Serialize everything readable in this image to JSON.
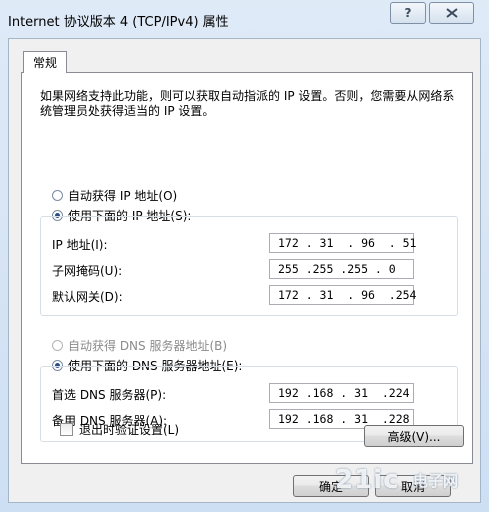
{
  "window": {
    "title": "Internet 协议版本 4 (TCP/IPv4) 属性",
    "help_glyph": "?",
    "close_glyph": "⌧"
  },
  "tabs": [
    {
      "label": "常规"
    }
  ],
  "description": "如果网络支持此功能，则可以获取自动指派的 IP 设置。否则，您需要从网络系统管理员处获得适当的 IP 设置。",
  "ip_section": {
    "auto_label": "自动获得 IP 地址(O)",
    "manual_label": "使用下面的 IP 地址(S):",
    "selected": "manual",
    "fields": [
      {
        "label": "IP 地址(I):",
        "value": "172 . 31  . 96  . 51"
      },
      {
        "label": "子网掩码(U):",
        "value": "255 .255 .255 . 0"
      },
      {
        "label": "默认网关(D):",
        "value": "172 . 31  . 96  .254"
      }
    ]
  },
  "dns_section": {
    "auto_label": "自动获得 DNS 服务器地址(B)",
    "manual_label": "使用下面的 DNS 服务器地址(E):",
    "selected": "manual",
    "fields": [
      {
        "label": "首选 DNS 服务器(P):",
        "value": "192 .168 . 31  .224"
      },
      {
        "label": "备用 DNS 服务器(A):",
        "value": "192 .168 . 31  .228"
      }
    ]
  },
  "validate_checkbox": {
    "label": "退出时验证设置(L)",
    "checked": false
  },
  "buttons": {
    "advanced": "高级(V)...",
    "ok": "确定",
    "cancel": "取消"
  },
  "watermark": {
    "main": "21ic",
    "sub": "电子网"
  }
}
